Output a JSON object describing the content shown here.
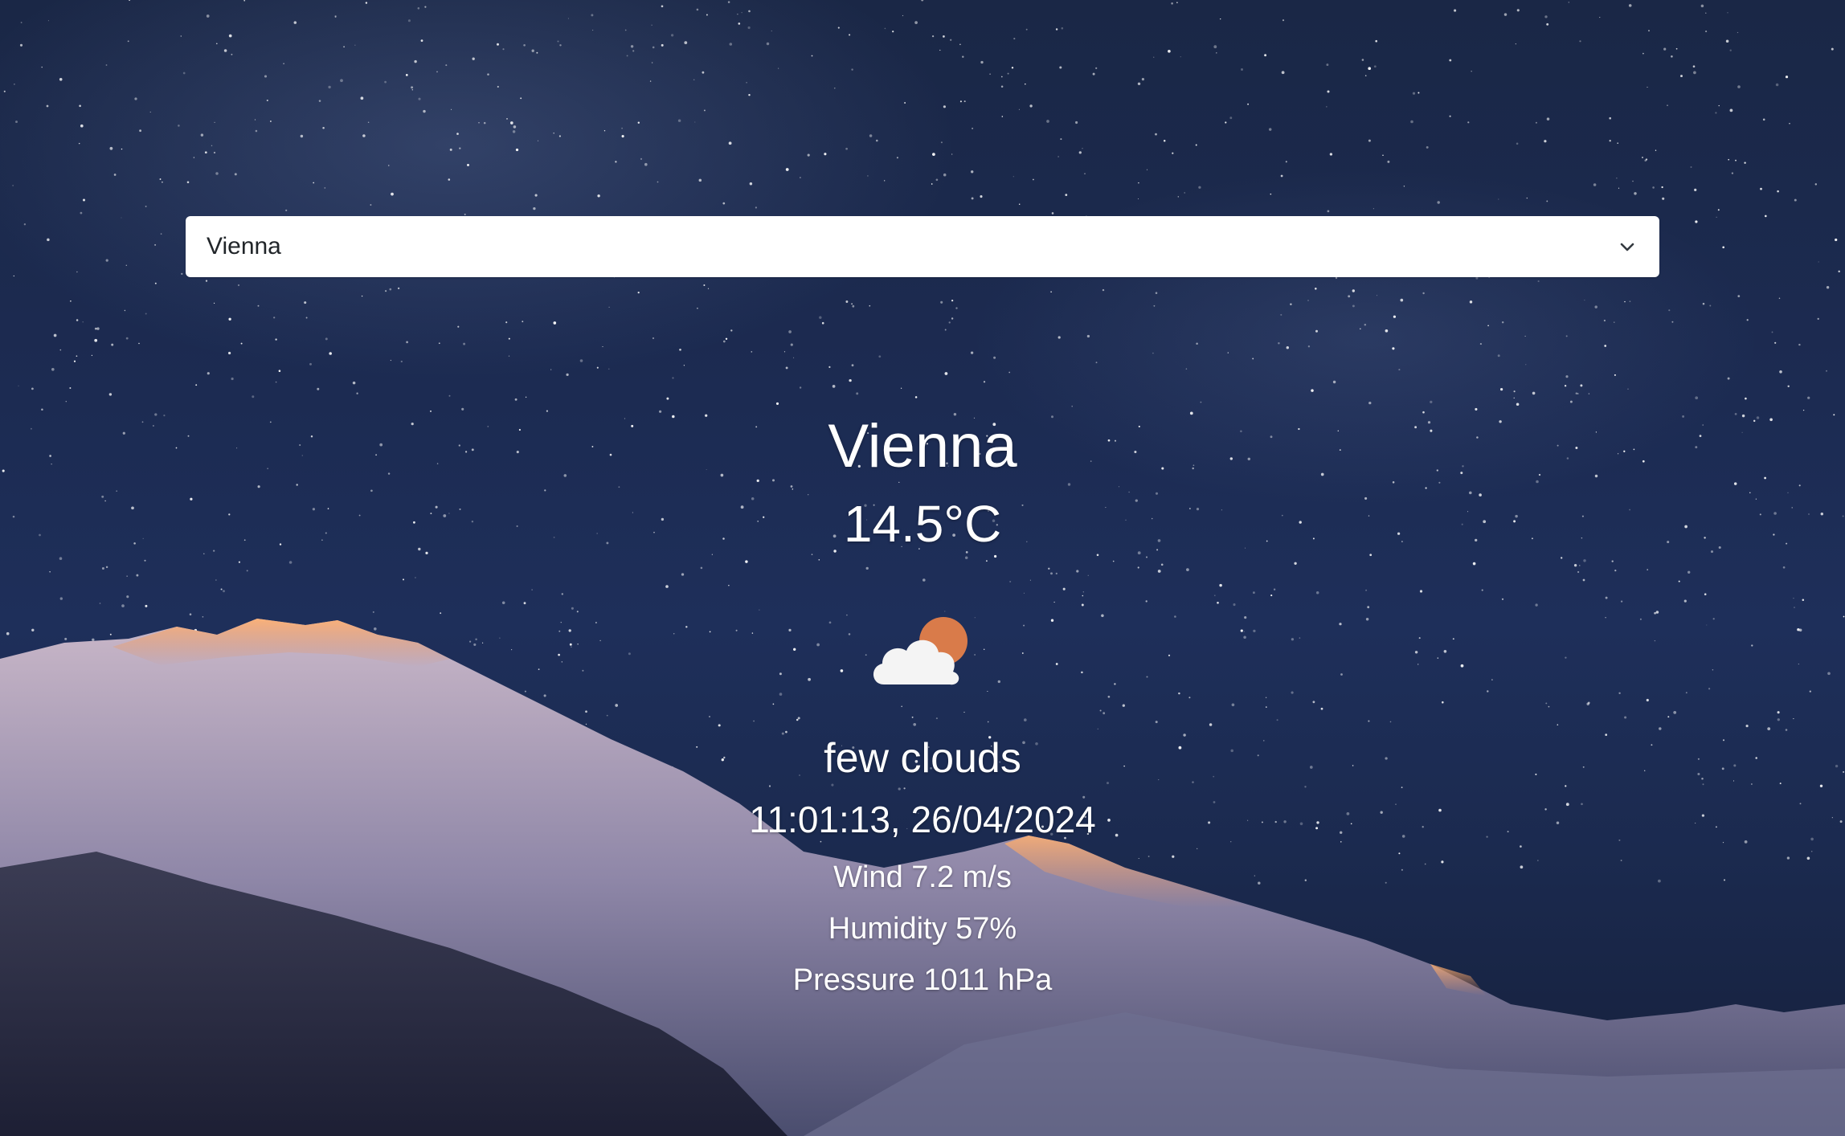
{
  "select": {
    "value": "Vienna"
  },
  "weather": {
    "city": "Vienna",
    "temperature": "14.5°C",
    "icon": "few-clouds-day-icon",
    "description": "few clouds",
    "datetime": "11:01:13, 26/04/2024",
    "wind": "Wind 7.2 m/s",
    "humidity": "Humidity 57%",
    "pressure": "Pressure 1011 hPa"
  },
  "colors": {
    "sky": "#1c2b52",
    "sun": "#d97b4a",
    "cloud": "#f4f4f4",
    "text": "#ffffff"
  }
}
